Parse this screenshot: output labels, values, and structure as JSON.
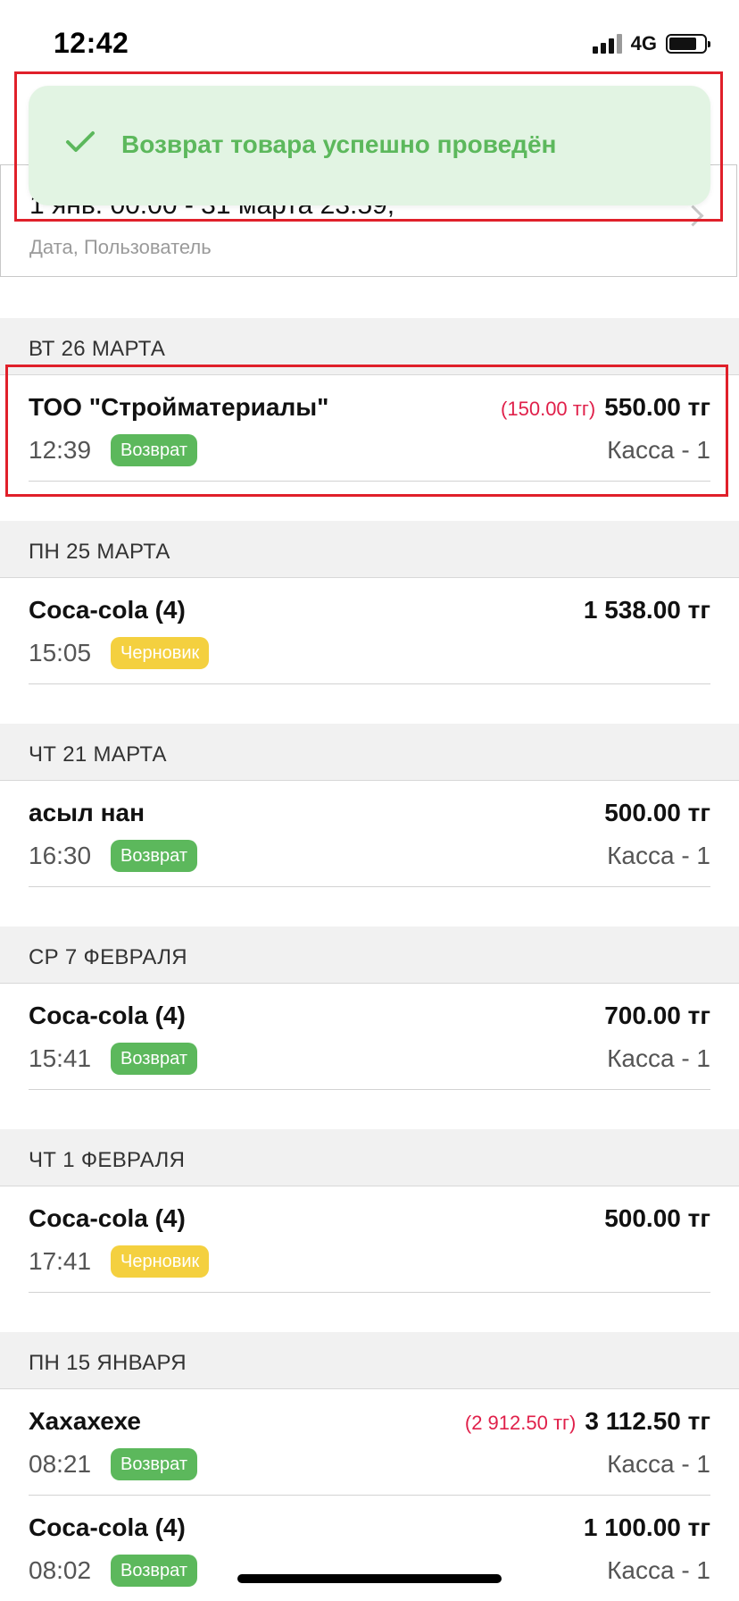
{
  "status_bar": {
    "time": "12:42",
    "network": "4G"
  },
  "filter": {
    "value": "1 янв. 00:00 - 31 марта 23:59,",
    "label": "Дата, Пользователь"
  },
  "toast": {
    "message": "Возврат товара успешно проведён",
    "color": "#5cb85c",
    "background": "#e2f4e3"
  },
  "colors": {
    "return_badge": "#5cb85c",
    "draft_badge": "#f4d03f",
    "diff_text": "#e0204a",
    "highlight": "#e0202a"
  },
  "sections": [
    {
      "header": "ВТ 26 МАРТА",
      "rows": [
        {
          "name": "ТОО \"Стройматериалы\"",
          "time": "12:39",
          "badge": "Возврат",
          "diff": "(150.00 тг)",
          "amount": "550.00 тг",
          "register": "Касса - 1"
        }
      ]
    },
    {
      "header": "ПН 25 МАРТА",
      "rows": [
        {
          "name": "Coca-cola (4)",
          "time": "15:05",
          "badge": "Черновик",
          "diff": "",
          "amount": "1 538.00 тг",
          "register": ""
        }
      ]
    },
    {
      "header": "ЧТ 21 МАРТА",
      "rows": [
        {
          "name": "асыл нан",
          "time": "16:30",
          "badge": "Возврат",
          "diff": "",
          "amount": "500.00 тг",
          "register": "Касса - 1"
        }
      ]
    },
    {
      "header": "СР 7 ФЕВРАЛЯ",
      "rows": [
        {
          "name": "Coca-cola (4)",
          "time": "15:41",
          "badge": "Возврат",
          "diff": "",
          "amount": "700.00 тг",
          "register": "Касса - 1"
        }
      ]
    },
    {
      "header": "ЧТ 1 ФЕВРАЛЯ",
      "rows": [
        {
          "name": "Coca-cola (4)",
          "time": "17:41",
          "badge": "Черновик",
          "diff": "",
          "amount": "500.00 тг",
          "register": ""
        }
      ]
    },
    {
      "header": "ПН 15 ЯНВАРЯ",
      "rows": [
        {
          "name": "Хахахехе",
          "time": "08:21",
          "badge": "Возврат",
          "diff": "(2 912.50 тг)",
          "amount": "3 112.50 тг",
          "register": "Касса - 1"
        },
        {
          "name": "Coca-cola (4)",
          "time": "08:02",
          "badge": "Возврат",
          "diff": "",
          "amount": "1 100.00 тг",
          "register": "Касса - 1"
        }
      ]
    }
  ]
}
